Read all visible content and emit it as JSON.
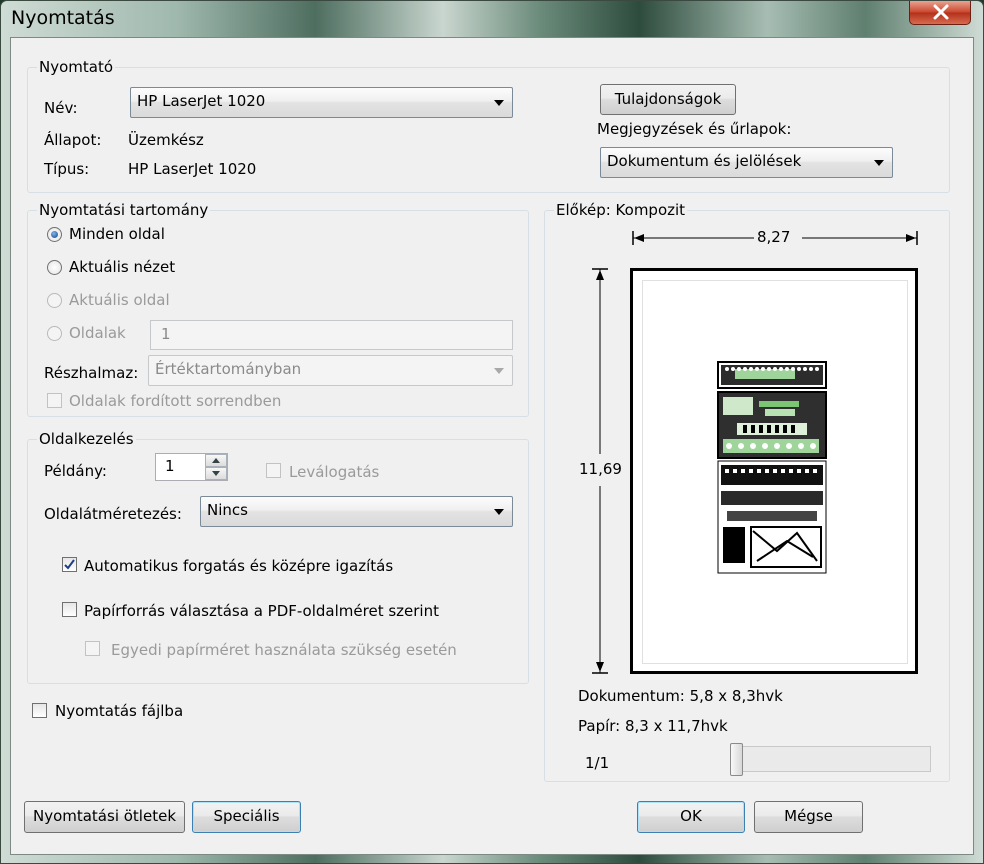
{
  "window": {
    "title": "Nyomtatás"
  },
  "printer": {
    "legend": "Nyomtató",
    "name_label": "Név:",
    "name_value": "HP LaserJet 1020",
    "status_label": "Állapot:",
    "status_value": "Üzemkész",
    "type_label": "Típus:",
    "type_value": "HP LaserJet 1020",
    "properties_button": "Tulajdonságok",
    "comments_label": "Megjegyzések és űrlapok:",
    "comments_value": "Dokumentum és jelölések"
  },
  "range": {
    "legend": "Nyomtatási tartomány",
    "all_pages": "Minden oldal",
    "current_view": "Aktuális nézet",
    "current_page": "Aktuális oldal",
    "pages": "Oldalak",
    "pages_value": "1",
    "subset_label": "Részhalmaz:",
    "subset_value": "Értéktartományban",
    "reverse": "Oldalak fordított sorrendben"
  },
  "handling": {
    "legend": "Oldalkezelés",
    "copies_label": "Példány:",
    "copies_value": "1",
    "collate": "Leválogatás",
    "scaling_label": "Oldalátméretezés:",
    "scaling_value": "Nincs",
    "autorotate": "Automatikus forgatás és középre igazítás",
    "autorotate_checked": true,
    "paper_source": "Papírforrás választása a PDF-oldalméret szerint",
    "paper_source_checked": false,
    "custom_paper": "Egyedi papírméret használata szükség esetén"
  },
  "print_to_file": "Nyomtatás fájlba",
  "preview": {
    "legend": "Előkép: Kompozit",
    "width_value": "8,27",
    "height_value": "11,69",
    "document_size": "Dokumentum: 5,8 x 8,3hvk",
    "paper_size": "Papír: 8,3 x 11,7hvk",
    "page_counter": "1/1"
  },
  "buttons": {
    "tips": "Nyomtatási ötletek",
    "advanced": "Speciális",
    "ok": "OK",
    "cancel": "Mégse"
  },
  "colors": {
    "accent": "#3c7fb1",
    "close": "#c9452b"
  }
}
